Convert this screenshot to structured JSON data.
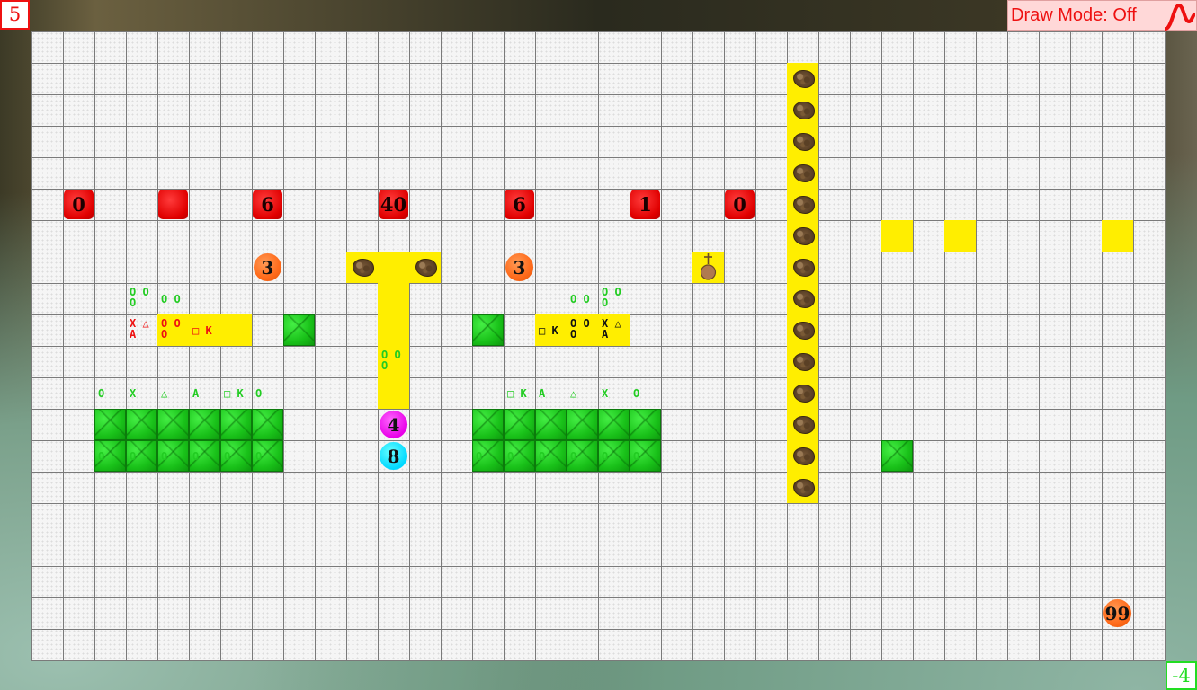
{
  "top_left_counter": "5",
  "bottom_right_counter": "-4",
  "draw_mode": {
    "label": "Draw Mode: Off",
    "icon": "draw-wave-icon"
  },
  "colors": {
    "yellow": "#ffee00",
    "red": "#e00000",
    "orange": "#ff6a1a",
    "magenta": "#e800e8",
    "cyan": "#00d8ff",
    "grass": "#19c119"
  },
  "board": {
    "cols": 36,
    "rows": 20,
    "red_tiles": [
      {
        "col": 1,
        "row": 5,
        "label": "0"
      },
      {
        "col": 4,
        "row": 5,
        "label": ""
      },
      {
        "col": 7,
        "row": 5,
        "label": "6"
      },
      {
        "col": 11,
        "row": 5,
        "label": "40"
      },
      {
        "col": 15,
        "row": 5,
        "label": "6"
      },
      {
        "col": 19,
        "row": 5,
        "label": "1"
      },
      {
        "col": 22,
        "row": 5,
        "label": "0"
      }
    ],
    "circles": [
      {
        "col": 7,
        "row": 7,
        "label": "3",
        "color": "orange"
      },
      {
        "col": 15,
        "row": 7,
        "label": "3",
        "color": "orange"
      },
      {
        "col": 11,
        "row": 12,
        "label": "4",
        "color": "magenta"
      },
      {
        "col": 11,
        "row": 13,
        "label": "8",
        "color": "cyan"
      },
      {
        "col": 34,
        "row": 18,
        "label": "99",
        "color": "orange"
      }
    ],
    "yellow_cells": [
      {
        "col": 10,
        "row": 7
      },
      {
        "col": 11,
        "row": 7
      },
      {
        "col": 12,
        "row": 7
      },
      {
        "col": 11,
        "row": 8
      },
      {
        "col": 11,
        "row": 9
      },
      {
        "col": 11,
        "row": 10
      },
      {
        "col": 11,
        "row": 11
      },
      {
        "col": 21,
        "row": 7
      },
      {
        "col": 4,
        "row": 9
      },
      {
        "col": 5,
        "row": 9
      },
      {
        "col": 6,
        "row": 9
      },
      {
        "col": 16,
        "row": 9
      },
      {
        "col": 17,
        "row": 9
      },
      {
        "col": 18,
        "row": 9
      },
      {
        "col": 27,
        "row": 6
      },
      {
        "col": 29,
        "row": 6
      },
      {
        "col": 34,
        "row": 6
      },
      {
        "col": 24,
        "row": 1
      },
      {
        "col": 24,
        "row": 2
      },
      {
        "col": 24,
        "row": 3
      },
      {
        "col": 24,
        "row": 4
      },
      {
        "col": 24,
        "row": 5
      },
      {
        "col": 24,
        "row": 6
      },
      {
        "col": 24,
        "row": 7
      },
      {
        "col": 24,
        "row": 8
      },
      {
        "col": 24,
        "row": 9
      },
      {
        "col": 24,
        "row": 10
      },
      {
        "col": 24,
        "row": 11
      },
      {
        "col": 24,
        "row": 12
      },
      {
        "col": 24,
        "row": 13
      },
      {
        "col": 24,
        "row": 14
      }
    ],
    "rocks": [
      {
        "col": 10,
        "row": 7
      },
      {
        "col": 12,
        "row": 7
      },
      {
        "col": 24,
        "row": 1
      },
      {
        "col": 24,
        "row": 2
      },
      {
        "col": 24,
        "row": 3
      },
      {
        "col": 24,
        "row": 4
      },
      {
        "col": 24,
        "row": 5
      },
      {
        "col": 24,
        "row": 6
      },
      {
        "col": 24,
        "row": 7
      },
      {
        "col": 24,
        "row": 8
      },
      {
        "col": 24,
        "row": 9
      },
      {
        "col": 24,
        "row": 10
      },
      {
        "col": 24,
        "row": 11
      },
      {
        "col": 24,
        "row": 12
      },
      {
        "col": 24,
        "row": 13
      },
      {
        "col": 24,
        "row": 14
      }
    ],
    "tomb": {
      "col": 21,
      "row": 7
    },
    "grass_cells": [
      {
        "col": 8,
        "row": 9
      },
      {
        "col": 14,
        "row": 9
      },
      {
        "col": 27,
        "row": 13
      },
      {
        "col": 2,
        "row": 12
      },
      {
        "col": 3,
        "row": 12
      },
      {
        "col": 4,
        "row": 12
      },
      {
        "col": 5,
        "row": 12
      },
      {
        "col": 6,
        "row": 12
      },
      {
        "col": 7,
        "row": 12
      },
      {
        "col": 2,
        "row": 13
      },
      {
        "col": 3,
        "row": 13
      },
      {
        "col": 4,
        "row": 13
      },
      {
        "col": 5,
        "row": 13
      },
      {
        "col": 6,
        "row": 13
      },
      {
        "col": 7,
        "row": 13
      },
      {
        "col": 14,
        "row": 12
      },
      {
        "col": 15,
        "row": 12
      },
      {
        "col": 16,
        "row": 12
      },
      {
        "col": 17,
        "row": 12
      },
      {
        "col": 18,
        "row": 12
      },
      {
        "col": 19,
        "row": 12
      },
      {
        "col": 14,
        "row": 13
      },
      {
        "col": 15,
        "row": 13
      },
      {
        "col": 16,
        "row": 13
      },
      {
        "col": 17,
        "row": 13
      },
      {
        "col": 18,
        "row": 13
      },
      {
        "col": 19,
        "row": 13
      }
    ],
    "marks": [
      {
        "col": 3,
        "row": 8,
        "text": "O O\nO",
        "color": "green"
      },
      {
        "col": 4,
        "row": 8,
        "text": "O O",
        "color": "green"
      },
      {
        "col": 17,
        "row": 8,
        "text": "O O",
        "color": "green"
      },
      {
        "col": 18,
        "row": 8,
        "text": "O O\nO",
        "color": "green"
      },
      {
        "col": 3,
        "row": 9,
        "text": "X △\nA",
        "color": "red"
      },
      {
        "col": 4,
        "row": 9,
        "text": "O O\nO",
        "color": "red"
      },
      {
        "col": 5,
        "row": 9,
        "text": "□ K",
        "color": "red"
      },
      {
        "col": 16,
        "row": 9,
        "text": "□ K",
        "color": "black"
      },
      {
        "col": 17,
        "row": 9,
        "text": "O O\nO",
        "color": "black"
      },
      {
        "col": 18,
        "row": 9,
        "text": "X △\nA",
        "color": "black"
      },
      {
        "col": 11,
        "row": 10,
        "text": "O O\nO",
        "color": "green"
      },
      {
        "col": 2,
        "row": 11,
        "text": "O",
        "color": "green"
      },
      {
        "col": 3,
        "row": 11,
        "text": "X",
        "color": "green"
      },
      {
        "col": 4,
        "row": 11,
        "text": "△",
        "color": "green"
      },
      {
        "col": 5,
        "row": 11,
        "text": "A",
        "color": "green"
      },
      {
        "col": 6,
        "row": 11,
        "text": "□ K",
        "color": "green"
      },
      {
        "col": 7,
        "row": 11,
        "text": "O",
        "color": "green"
      },
      {
        "col": 15,
        "row": 11,
        "text": "□ K",
        "color": "green"
      },
      {
        "col": 16,
        "row": 11,
        "text": "A",
        "color": "green"
      },
      {
        "col": 17,
        "row": 11,
        "text": "△",
        "color": "green"
      },
      {
        "col": 18,
        "row": 11,
        "text": "X",
        "color": "green"
      },
      {
        "col": 19,
        "row": 11,
        "text": "O",
        "color": "green"
      },
      {
        "col": 2,
        "row": 13,
        "text": "O",
        "color": "green"
      },
      {
        "col": 3,
        "row": 13,
        "text": "O",
        "color": "green"
      },
      {
        "col": 4,
        "row": 13,
        "text": "O",
        "color": "green"
      },
      {
        "col": 5,
        "row": 13,
        "text": "O",
        "color": "green"
      },
      {
        "col": 6,
        "row": 13,
        "text": "O",
        "color": "green"
      },
      {
        "col": 7,
        "row": 13,
        "text": "O",
        "color": "green"
      },
      {
        "col": 14,
        "row": 13,
        "text": "O",
        "color": "green"
      },
      {
        "col": 15,
        "row": 13,
        "text": "O",
        "color": "green"
      },
      {
        "col": 16,
        "row": 13,
        "text": "O",
        "color": "green"
      },
      {
        "col": 17,
        "row": 13,
        "text": "O",
        "color": "green"
      },
      {
        "col": 18,
        "row": 13,
        "text": "O",
        "color": "green"
      },
      {
        "col": 19,
        "row": 13,
        "text": "O",
        "color": "green"
      }
    ]
  }
}
